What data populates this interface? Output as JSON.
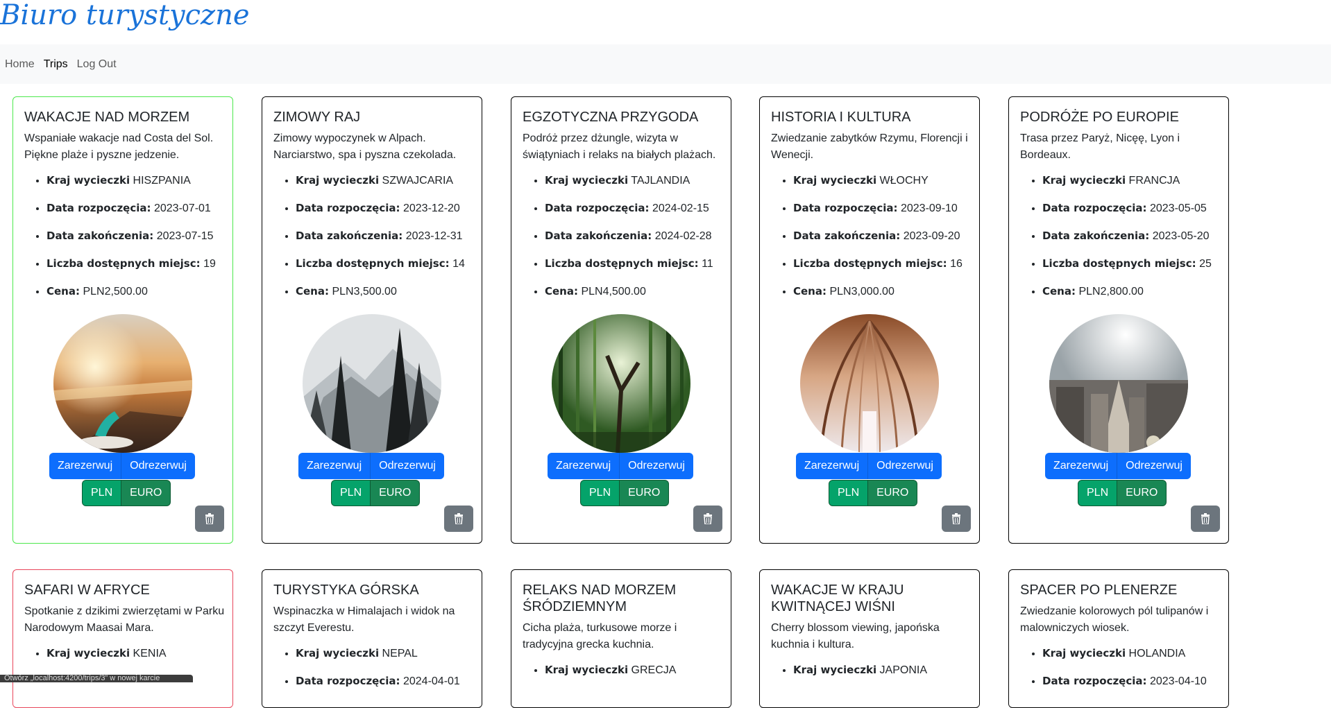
{
  "site": {
    "title": "Biuro turystyczne"
  },
  "nav": {
    "items": [
      {
        "label": "Home"
      },
      {
        "label": "Trips"
      },
      {
        "label": "Log Out"
      }
    ]
  },
  "labels": {
    "country": "Kraj wycieczki",
    "start": "Data rozpoczęcia:",
    "end": "Data zakończenia:",
    "seats": "Liczba dostępnych miejsc:",
    "price": "Cena:",
    "book": "Zarezerwuj",
    "unbook": "Odrezerwuj",
    "pln": "PLN",
    "euro": "EURO"
  },
  "trips": [
    {
      "title": "WAKACJE NAD MORZEM",
      "description": "Wspaniałe wakacje nad Costa del Sol. Piękne plaże i pyszne jedzenie.",
      "country": "HISZPANIA",
      "start": "2023-07-01",
      "end": "2023-07-15",
      "seats": "19",
      "price": "PLN2,500.00",
      "image": "beach-sunset-image",
      "highlight": "green"
    },
    {
      "title": "ZIMOWY RAJ",
      "description": "Zimowy wypoczynek w Alpach. Narciarstwo, spa i pyszna czekolada.",
      "country": "SZWAJCARIA",
      "start": "2023-12-20",
      "end": "2023-12-31",
      "seats": "14",
      "price": "PLN3,500.00",
      "image": "snowy-mountains-image"
    },
    {
      "title": "EGZOTYCZNA PRZYGODA",
      "description": "Podróż przez dżungle, wizyta w świątyniach i relaks na białych plażach.",
      "country": "TAJLANDIA",
      "start": "2024-02-15",
      "end": "2024-02-28",
      "seats": "11",
      "price": "PLN4,500.00",
      "image": "bamboo-forest-image"
    },
    {
      "title": "HISTORIA I KULTURA",
      "description": "Zwiedzanie zabytków Rzymu, Florencji i Wenecji.",
      "country": "WŁOCHY",
      "start": "2023-09-10",
      "end": "2023-09-20",
      "seats": "16",
      "price": "PLN3,000.00",
      "image": "cathedral-arches-image"
    },
    {
      "title": "PODRÓŻE PO EUROPIE",
      "description": "Trasa przez Paryż, Nicęę, Lyon i Bordeaux.",
      "country": "FRANCJA",
      "start": "2023-05-05",
      "end": "2023-05-20",
      "seats": "25",
      "price": "PLN2,800.00",
      "image": "city-skyline-image"
    },
    {
      "title": "SAFARI W AFRYCE",
      "description": "Spotkanie z dzikimi zwierzętami w Parku Narodowym Maasai Mara.",
      "country": "KENIA",
      "highlight": "red"
    },
    {
      "title": "TURYSTYKA GÓRSKA",
      "description": "Wspinaczka w Himalajach i widok na szczyt Everestu.",
      "country": "NEPAL",
      "start_partial": "2024-04-01"
    },
    {
      "title": "RELAKS NAD MORZEM ŚRÓDZIEMNYM",
      "description": "Cicha plaża, turkusowe morze i tradycyjna grecka kuchnia.",
      "country": "GRECJA"
    },
    {
      "title": "WAKACJE W KRAJU KWITNĄCEJ WIŚNI",
      "description": "Cherry blossom viewing, japońska kuchnia i kultura.",
      "country": "JAPONIA"
    },
    {
      "title": "SPACER PO PLENERZE",
      "description": "Zwiedzanie kolorowych pól tulipanów i malowniczych wiosek.",
      "country": "HOLANDIA",
      "start_partial": "2023-04-10"
    }
  ],
  "status_bar": {
    "text": "Otwórz „localhost:4200/trips/3” w nowej karcie"
  }
}
